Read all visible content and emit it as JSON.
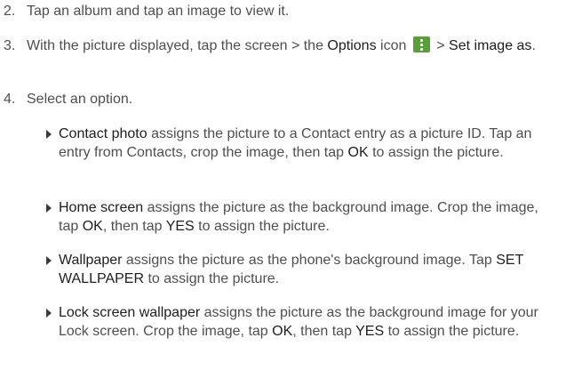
{
  "steps": [
    {
      "num": "2.",
      "text": "Tap an album and tap an image to view it."
    },
    {
      "num": "3.",
      "pre": "With the picture displayed, tap the screen > the ",
      "options": "Options",
      "mid": " icon ",
      "icon": "options-menu-icon",
      "gt": " > ",
      "set": "Set image as",
      "end": "."
    },
    {
      "num": "4.",
      "text": "Select an option."
    }
  ],
  "bullets": [
    {
      "term": "Contact photo",
      "a": " assigns the picture to a Contact entry as a picture ID. Tap an entry from Contacts, crop the image, then tap ",
      "b1": "OK",
      "c": " to assign the picture."
    },
    {
      "term": "Home screen",
      "a": " assigns the picture as the background image. Crop the image, tap ",
      "b1": "OK",
      "b": ", then tap ",
      "b2": "YES",
      "c": " to assign the picture."
    },
    {
      "term": "Wallpaper",
      "a": " assigns the picture as the phone's background image. Tap ",
      "b1": "SET WALLPAPER",
      "c": " to assign the picture."
    },
    {
      "term": "Lock screen wallpaper",
      "a": " assigns the picture as the background image for your Lock screen. Crop the image, tap ",
      "b1": "OK",
      "b": ", then tap ",
      "b2": "YES",
      "c": " to assign the picture."
    }
  ],
  "colors": {
    "text": "#4f4f4f",
    "emphasis": "#1e1e1e",
    "icon_bg": "#5a9e3b"
  }
}
